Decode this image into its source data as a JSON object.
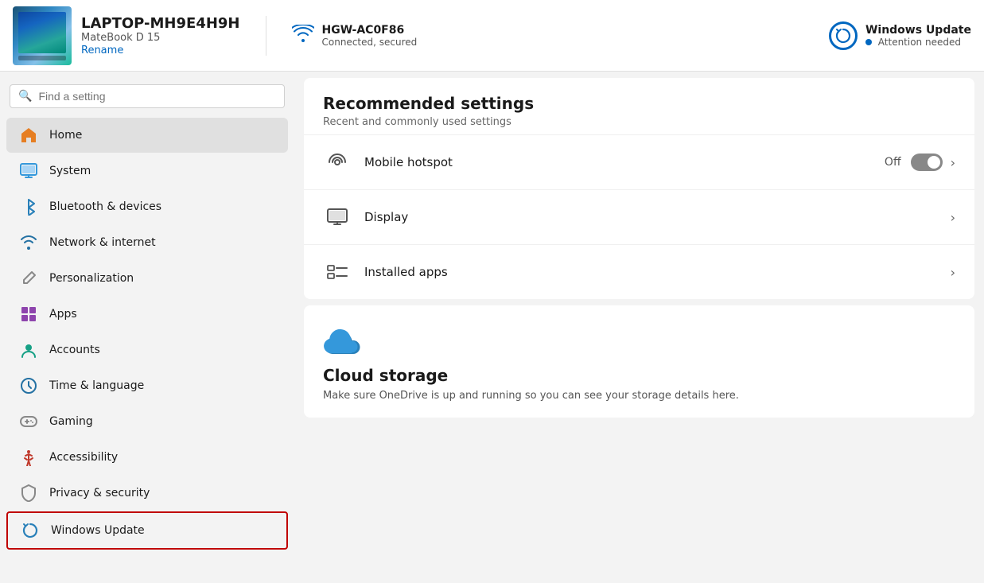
{
  "topbar": {
    "device_name": "LAPTOP-MH9E4H9H",
    "device_model": "MateBook D 15",
    "rename_label": "Rename",
    "wifi_name": "HGW-AC0F86",
    "wifi_status": "Connected, secured",
    "update_title": "Windows Update",
    "update_status": "Attention needed"
  },
  "search": {
    "placeholder": "Find a setting"
  },
  "nav": {
    "items": [
      {
        "id": "home",
        "label": "Home",
        "icon": "🏠",
        "icon_class": "icon-home",
        "active": true
      },
      {
        "id": "system",
        "label": "System",
        "icon": "🖥",
        "icon_class": "icon-system",
        "active": false
      },
      {
        "id": "bluetooth",
        "label": "Bluetooth & devices",
        "icon": "🔵",
        "icon_class": "icon-bluetooth",
        "active": false
      },
      {
        "id": "network",
        "label": "Network & internet",
        "icon": "📶",
        "icon_class": "icon-network",
        "active": false
      },
      {
        "id": "personalization",
        "label": "Personalization",
        "icon": "✏",
        "icon_class": "icon-personalization",
        "active": false
      },
      {
        "id": "apps",
        "label": "Apps",
        "icon": "🧩",
        "icon_class": "icon-apps",
        "active": false
      },
      {
        "id": "accounts",
        "label": "Accounts",
        "icon": "👤",
        "icon_class": "icon-accounts",
        "active": false
      },
      {
        "id": "time",
        "label": "Time & language",
        "icon": "🌐",
        "icon_class": "icon-time",
        "active": false
      },
      {
        "id": "gaming",
        "label": "Gaming",
        "icon": "🎮",
        "icon_class": "icon-gaming",
        "active": false
      },
      {
        "id": "accessibility",
        "label": "Accessibility",
        "icon": "♿",
        "icon_class": "icon-accessibility",
        "active": false
      },
      {
        "id": "privacy",
        "label": "Privacy & security",
        "icon": "🛡",
        "icon_class": "icon-privacy",
        "active": false
      },
      {
        "id": "update",
        "label": "Windows Update",
        "icon": "🔄",
        "icon_class": "icon-update",
        "active": false,
        "highlighted": true
      }
    ]
  },
  "recommended": {
    "title": "Recommended settings",
    "subtitle": "Recent and commonly used settings",
    "rows": [
      {
        "id": "hotspot",
        "label": "Mobile hotspot",
        "value": "Off",
        "has_toggle": true,
        "has_chevron": true
      },
      {
        "id": "display",
        "label": "Display",
        "value": "",
        "has_toggle": false,
        "has_chevron": true
      },
      {
        "id": "installed_apps",
        "label": "Installed apps",
        "value": "",
        "has_toggle": false,
        "has_chevron": true
      }
    ]
  },
  "cloud": {
    "title": "Cloud storage",
    "description": "Make sure OneDrive is up and running so you can see your storage details here."
  }
}
